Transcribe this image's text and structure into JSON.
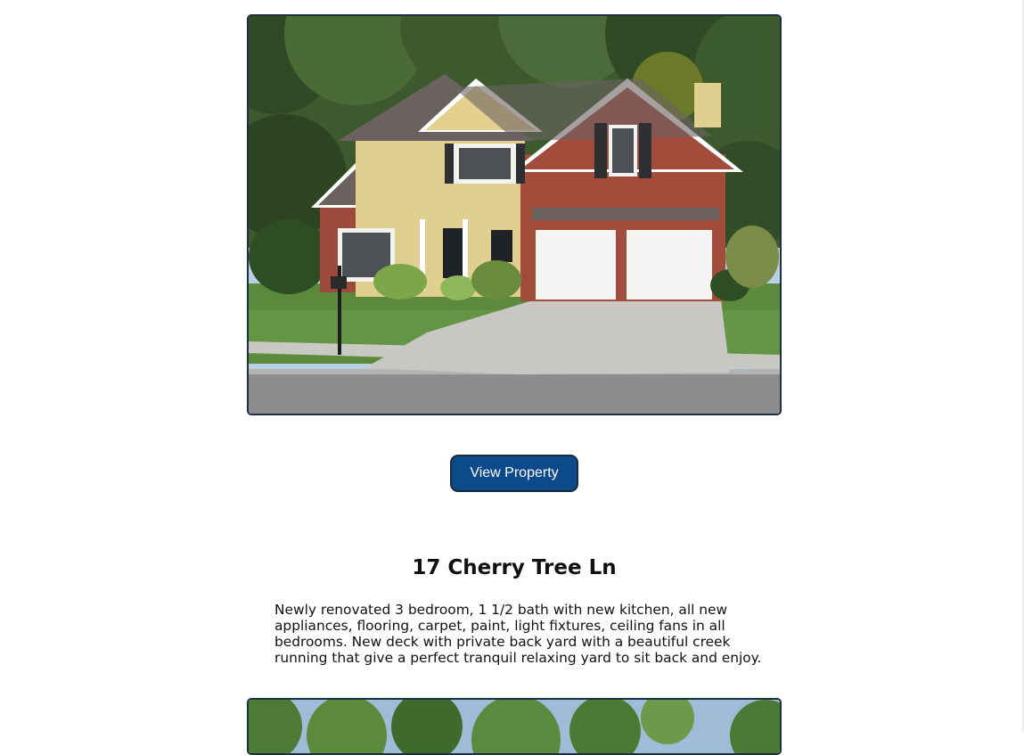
{
  "listing": {
    "button_label": "View Property",
    "address": "17 Cherry Tree Ln",
    "description": "Newly renovated 3 bedroom, 1 1/2 bath with new kitchen, all new appliances, flooring, carpet, paint, light fixtures, ceiling fans in all bedrooms. New deck with private back yard with a beautiful creek running that give a perfect tranquil relaxing yard to sit back and enjoy."
  },
  "colors": {
    "button_bg": "#0d4a8c",
    "button_border": "#1a2a38",
    "photo_border": "#1b3040"
  }
}
